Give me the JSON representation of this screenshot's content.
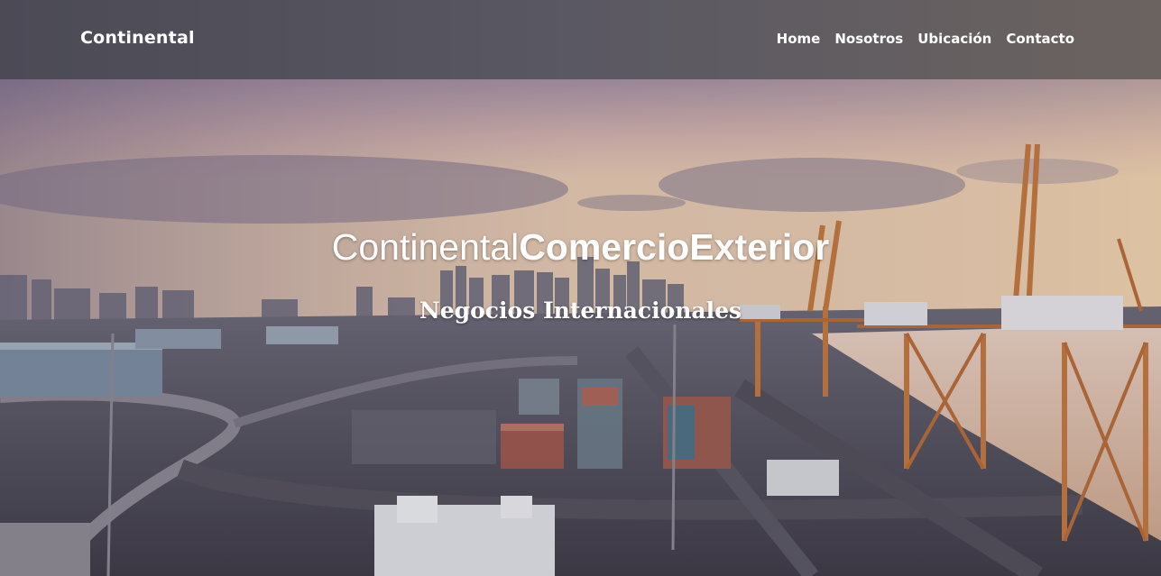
{
  "navbar": {
    "brand": "Continental",
    "links": [
      {
        "label": "Home"
      },
      {
        "label": "Nosotros"
      },
      {
        "label": "Ubicación"
      },
      {
        "label": "Contacto"
      }
    ]
  },
  "hero": {
    "title_light": "Continental",
    "title_bold": "ComercioExterior",
    "subtitle": "Negocios Internacionales"
  },
  "colors": {
    "navbar_bg": "#55535d",
    "text": "#ffffff",
    "sky_top": "#5e5772",
    "sky_horizon": "#f1d9b8"
  }
}
